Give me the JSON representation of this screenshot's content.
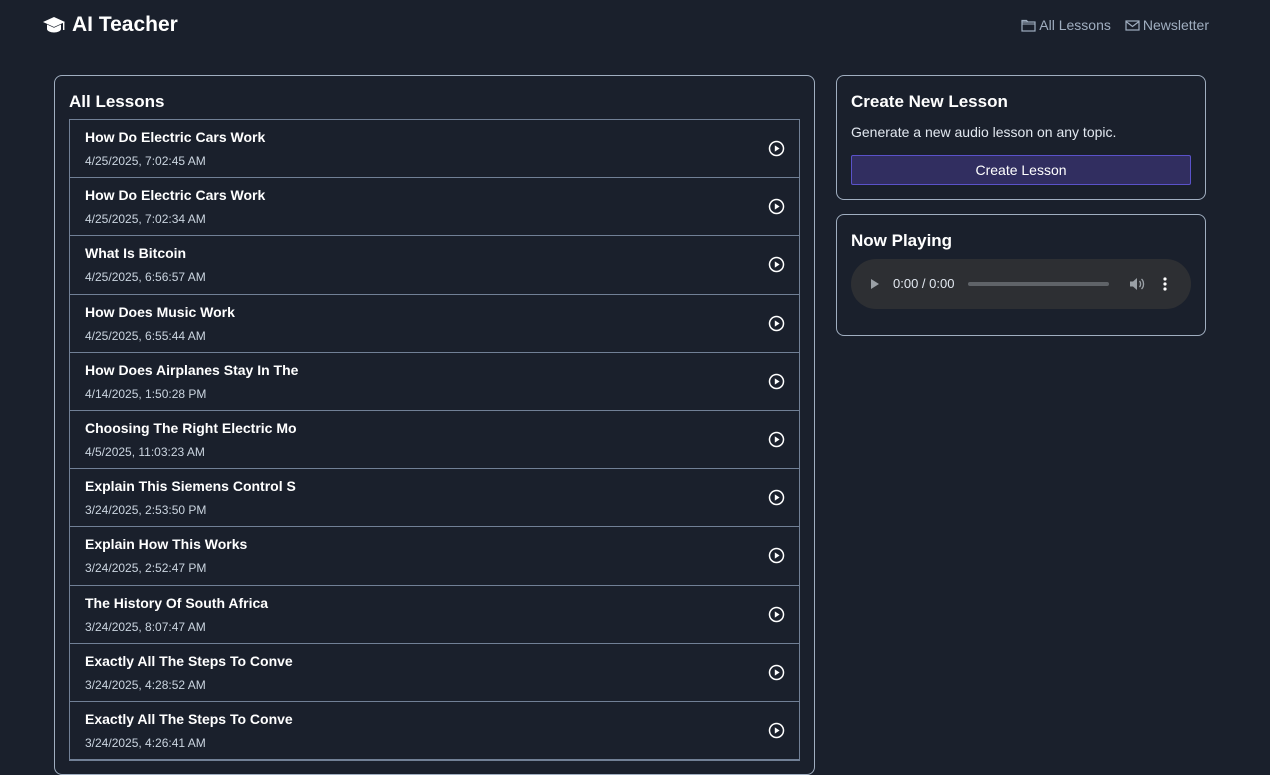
{
  "header": {
    "brand": "AI Teacher",
    "nav": [
      {
        "label": "All Lessons",
        "icon": "folder-icon"
      },
      {
        "label": "Newsletter",
        "icon": "mail-icon"
      }
    ]
  },
  "lessons": {
    "title": "All Lessons",
    "items": [
      {
        "title": "How Do Electric Cars Work",
        "date": "4/25/2025, 7:02:45 AM"
      },
      {
        "title": "How Do Electric Cars Work",
        "date": "4/25/2025, 7:02:34 AM"
      },
      {
        "title": "What Is Bitcoin",
        "date": "4/25/2025, 6:56:57 AM"
      },
      {
        "title": "How Does Music Work",
        "date": "4/25/2025, 6:55:44 AM"
      },
      {
        "title": "How Does Airplanes Stay In The",
        "date": "4/14/2025, 1:50:28 PM"
      },
      {
        "title": "Choosing The Right Electric Mo",
        "date": "4/5/2025, 11:03:23 AM"
      },
      {
        "title": "Explain This Siemens Control S",
        "date": "3/24/2025, 2:53:50 PM"
      },
      {
        "title": "Explain How This Works",
        "date": "3/24/2025, 2:52:47 PM"
      },
      {
        "title": "The History Of South Africa",
        "date": "3/24/2025, 8:07:47 AM"
      },
      {
        "title": "Exactly All The Steps To Conve",
        "date": "3/24/2025, 4:28:52 AM"
      },
      {
        "title": "Exactly All The Steps To Conve",
        "date": "3/24/2025, 4:26:41 AM"
      }
    ]
  },
  "create": {
    "title": "Create New Lesson",
    "description": "Generate a new audio lesson on any topic.",
    "button_label": "Create Lesson"
  },
  "now_playing": {
    "title": "Now Playing",
    "time": "0:00 / 0:00",
    "progress": 0
  },
  "colors": {
    "background": "#1a202c",
    "border": "#a0aec0",
    "button": "#312e60",
    "button_border": "#5a52c9",
    "player": "#2d2f33"
  }
}
